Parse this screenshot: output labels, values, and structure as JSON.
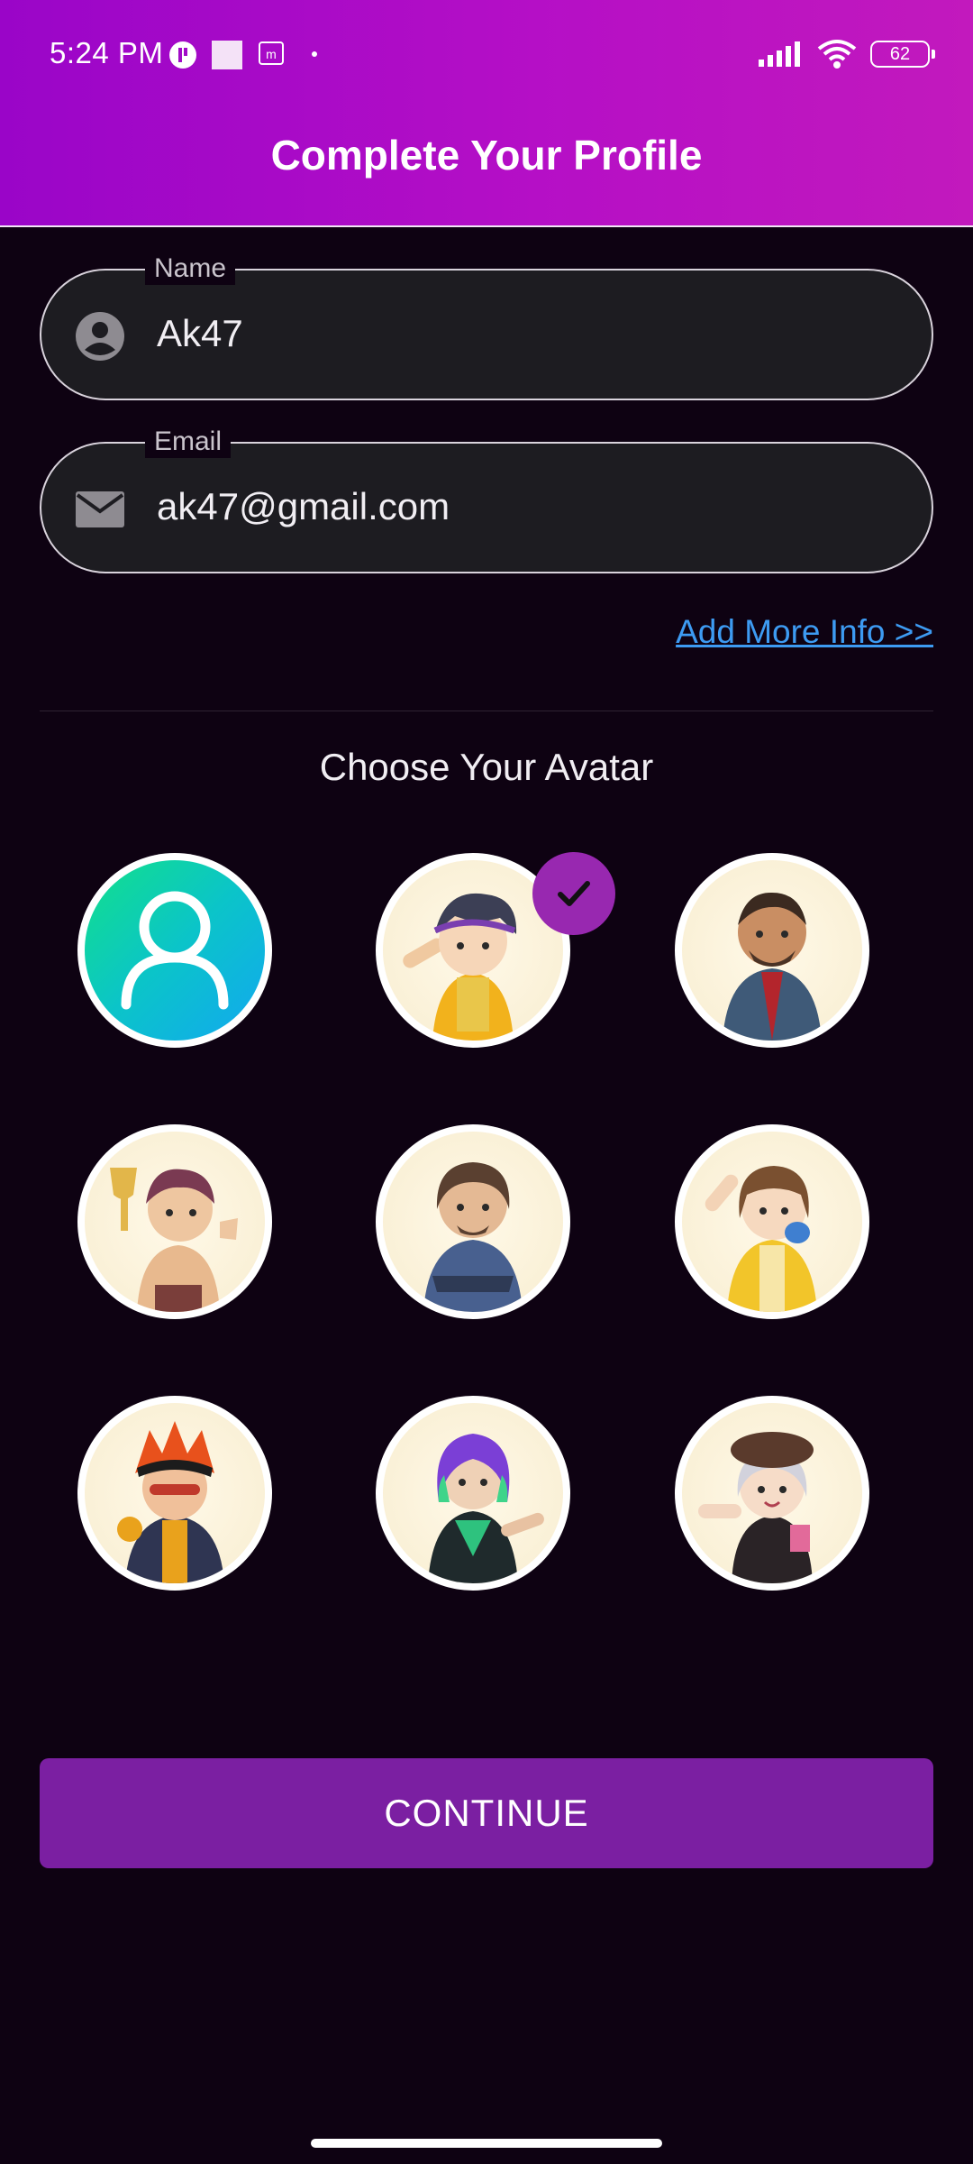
{
  "status_bar": {
    "time": "5:24 PM",
    "battery": "62"
  },
  "header": {
    "title": "Complete Your Profile"
  },
  "form": {
    "name": {
      "label": "Name",
      "value": "Ak47"
    },
    "email": {
      "label": "Email",
      "value": "ak47@gmail.com"
    }
  },
  "add_more_link": "Add More Info >>",
  "avatar_section": {
    "title": "Choose Your Avatar",
    "selected_index": 1
  },
  "continue_button": "CONTINUE",
  "colors": {
    "header_start": "#9a05c8",
    "header_end": "#c219bd",
    "accent": "#7b1fa2",
    "link": "#3d9bf2",
    "background": "#0e0212"
  }
}
